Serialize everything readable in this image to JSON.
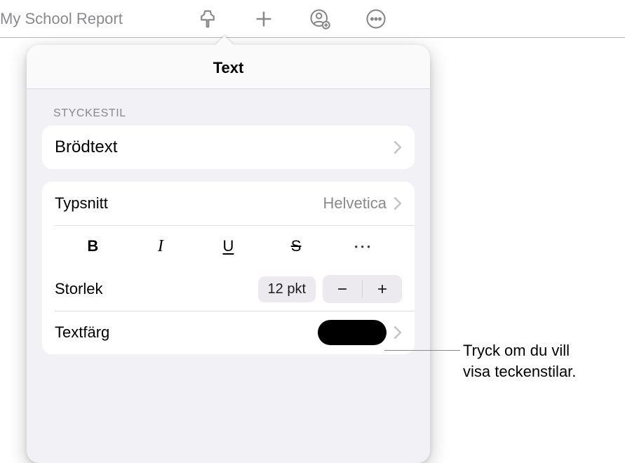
{
  "toolbar": {
    "doc_title": "My School Report"
  },
  "popover": {
    "title": "Text",
    "section_style_label": "STYCKESTIL",
    "paragraph_style": "Brödtext",
    "font": {
      "label": "Typsnitt",
      "value": "Helvetica"
    },
    "styles": {
      "bold": "B",
      "italic": "I",
      "underline": "U",
      "strike": "S",
      "more": "●●●"
    },
    "size": {
      "label": "Storlek",
      "value": "12 pkt"
    },
    "text_color": {
      "label": "Textfärg",
      "swatch_hex": "#000000"
    }
  },
  "callout": {
    "line1": "Tryck om du vill",
    "line2": "visa teckenstilar."
  }
}
